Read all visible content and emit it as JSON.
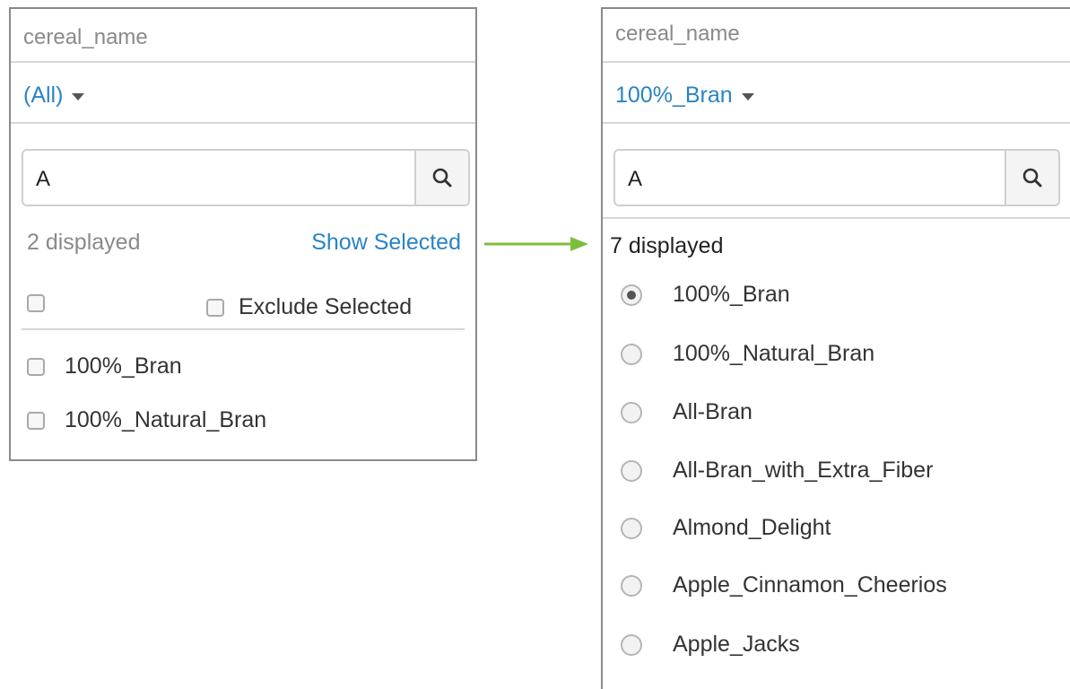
{
  "left_panel": {
    "field_label": "cereal_name",
    "selected_value": "(All)",
    "search_value": "A",
    "displayed_count": "2 displayed",
    "show_selected_label": "Show Selected",
    "exclude_selected_label": "Exclude Selected",
    "items": [
      {
        "label": "100%_Bran",
        "checked": false
      },
      {
        "label": "100%_Natural_Bran",
        "checked": false
      }
    ]
  },
  "right_panel": {
    "field_label": "cereal_name",
    "selected_value": "100%_Bran",
    "search_value": "A",
    "displayed_count": "7 displayed",
    "options": [
      {
        "label": "100%_Bran",
        "selected": true
      },
      {
        "label": "100%_Natural_Bran",
        "selected": false
      },
      {
        "label": "All-Bran",
        "selected": false
      },
      {
        "label": "All-Bran_with_Extra_Fiber",
        "selected": false
      },
      {
        "label": "Almond_Delight",
        "selected": false
      },
      {
        "label": "Apple_Cinnamon_Cheerios",
        "selected": false
      },
      {
        "label": "Apple_Jacks",
        "selected": false
      }
    ]
  },
  "colors": {
    "link_blue": "#2a84c3",
    "arrow_green": "#7cbf3f",
    "border_gray": "#8a8a8a"
  }
}
